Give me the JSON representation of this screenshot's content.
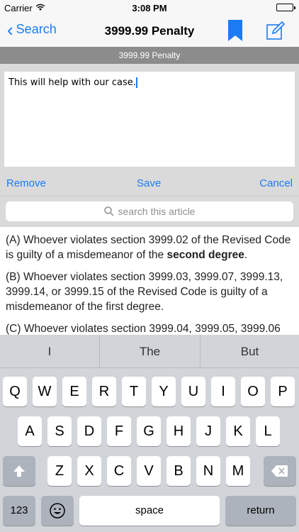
{
  "status_bar": {
    "carrier": "Carrier",
    "time": "3:08 PM"
  },
  "nav": {
    "back_label": "Search",
    "title": "3999.99 Penalty",
    "bookmark_icon": "bookmark-icon",
    "compose_icon": "compose-icon",
    "accent_color": "#1a7bf2"
  },
  "section_title": "3999.99 Penalty",
  "note": {
    "text": "This will help with our case.",
    "remove_label": "Remove",
    "save_label": "Save",
    "cancel_label": "Cancel"
  },
  "search": {
    "placeholder": "search this article"
  },
  "article": {
    "para_a_pre": "(A) Whoever violates section 3999.02 of the Revised Code is guilty of a misdemeanor of the ",
    "para_a_bold": "second degree",
    "para_a_post": ".",
    "para_b": "(B) Whoever violates section 3999.03, 3999.07, 3999.13, 3999.14, or 3999.15 of the Revised Code is guilty of a misdemeanor of the first degree.",
    "para_c": "(C) Whoever violates section 3999.04, 3999.05, 3999.06"
  },
  "keyboard": {
    "suggestions": [
      "I",
      "The",
      "But"
    ],
    "row1": [
      "Q",
      "W",
      "E",
      "R",
      "T",
      "Y",
      "U",
      "I",
      "O",
      "P"
    ],
    "row2": [
      "A",
      "S",
      "D",
      "F",
      "G",
      "H",
      "J",
      "K",
      "L"
    ],
    "row3": [
      "Z",
      "X",
      "C",
      "V",
      "B",
      "N",
      "M"
    ],
    "numbers_label": "123",
    "space_label": "space",
    "return_label": "return"
  }
}
